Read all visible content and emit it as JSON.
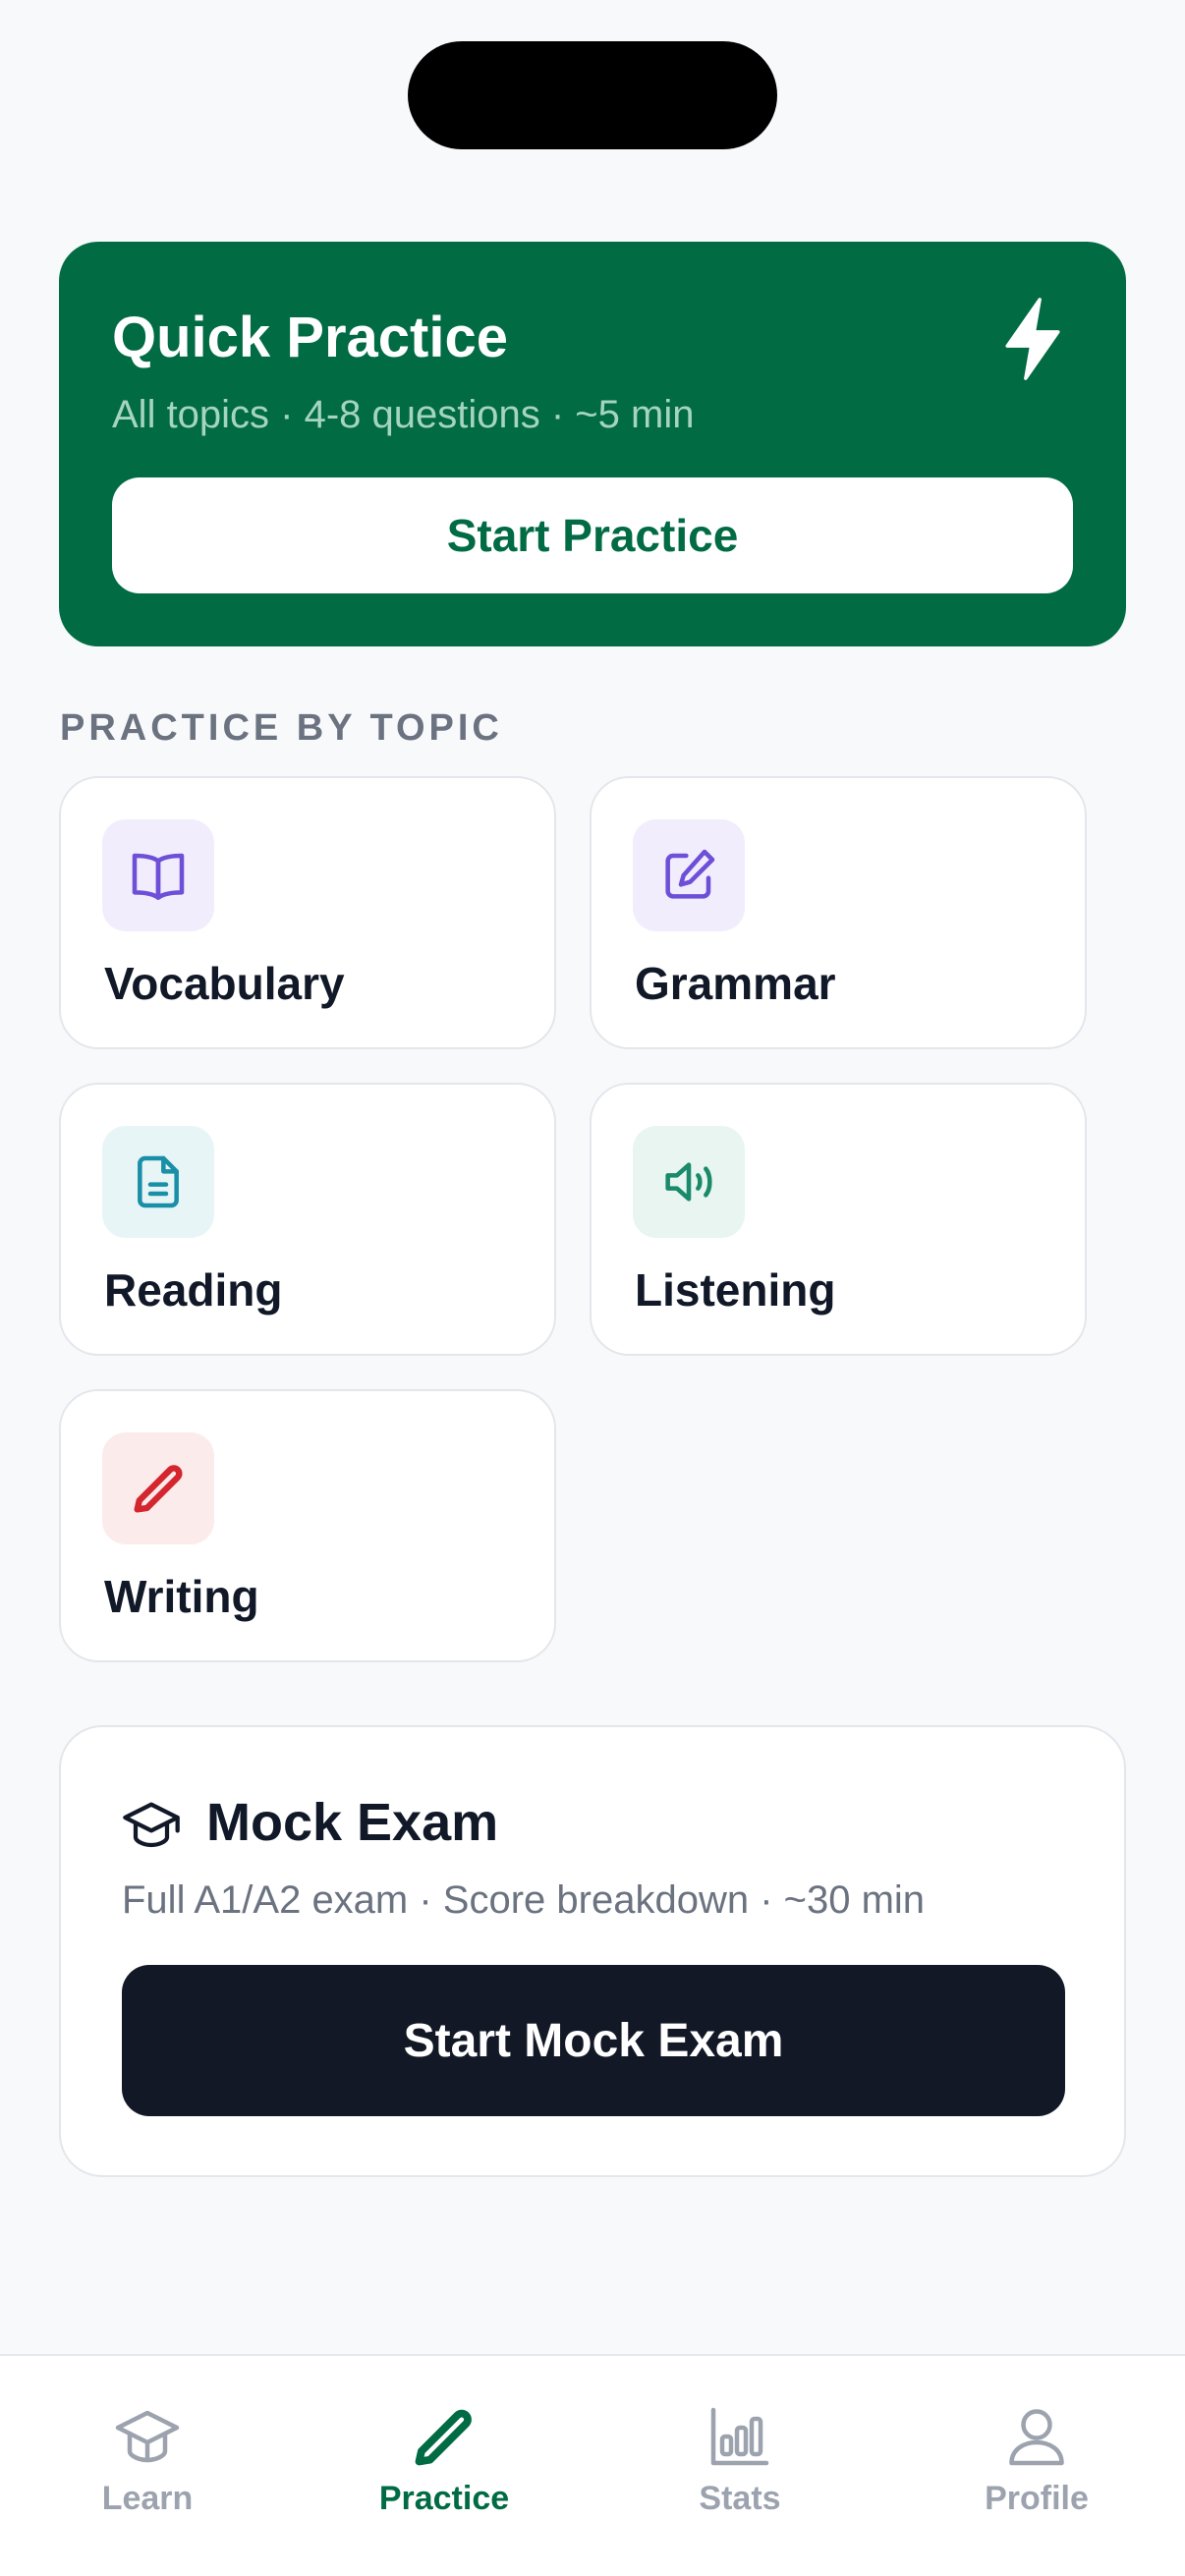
{
  "quick_practice": {
    "title": "Quick Practice",
    "subtitle": "All topics · 4-8 questions · ~5 min",
    "button_label": "Start Practice",
    "icon": "bolt-icon",
    "background_color": "#016b44"
  },
  "topics_section": {
    "label": "PRACTICE BY TOPIC",
    "items": [
      {
        "label": "Vocabulary",
        "icon": "book-open-icon",
        "icon_color": "#6d4fd8",
        "icon_bg": "#f1edfc"
      },
      {
        "label": "Grammar",
        "icon": "edit-square-icon",
        "icon_color": "#6d4fd8",
        "icon_bg": "#f1edfc"
      },
      {
        "label": "Reading",
        "icon": "document-icon",
        "icon_color": "#1a8fa8",
        "icon_bg": "#e8f5f6"
      },
      {
        "label": "Listening",
        "icon": "speaker-icon",
        "icon_color": "#1a8a6a",
        "icon_bg": "#e8f5f1"
      },
      {
        "label": "Writing",
        "icon": "pencil-icon",
        "icon_color": "#d4262f",
        "icon_bg": "#fcebeb"
      }
    ]
  },
  "mock_exam": {
    "title": "Mock Exam",
    "subtitle": "Full A1/A2 exam · Score breakdown · ~30 min",
    "button_label": "Start Mock Exam",
    "icon": "graduation-cap-icon"
  },
  "tabbar": {
    "active": "Practice",
    "accent_color": "#016b44",
    "items": [
      {
        "label": "Learn",
        "icon": "graduation-cap-icon"
      },
      {
        "label": "Practice",
        "icon": "pencil-icon"
      },
      {
        "label": "Stats",
        "icon": "bar-chart-icon"
      },
      {
        "label": "Profile",
        "icon": "user-icon"
      }
    ]
  }
}
